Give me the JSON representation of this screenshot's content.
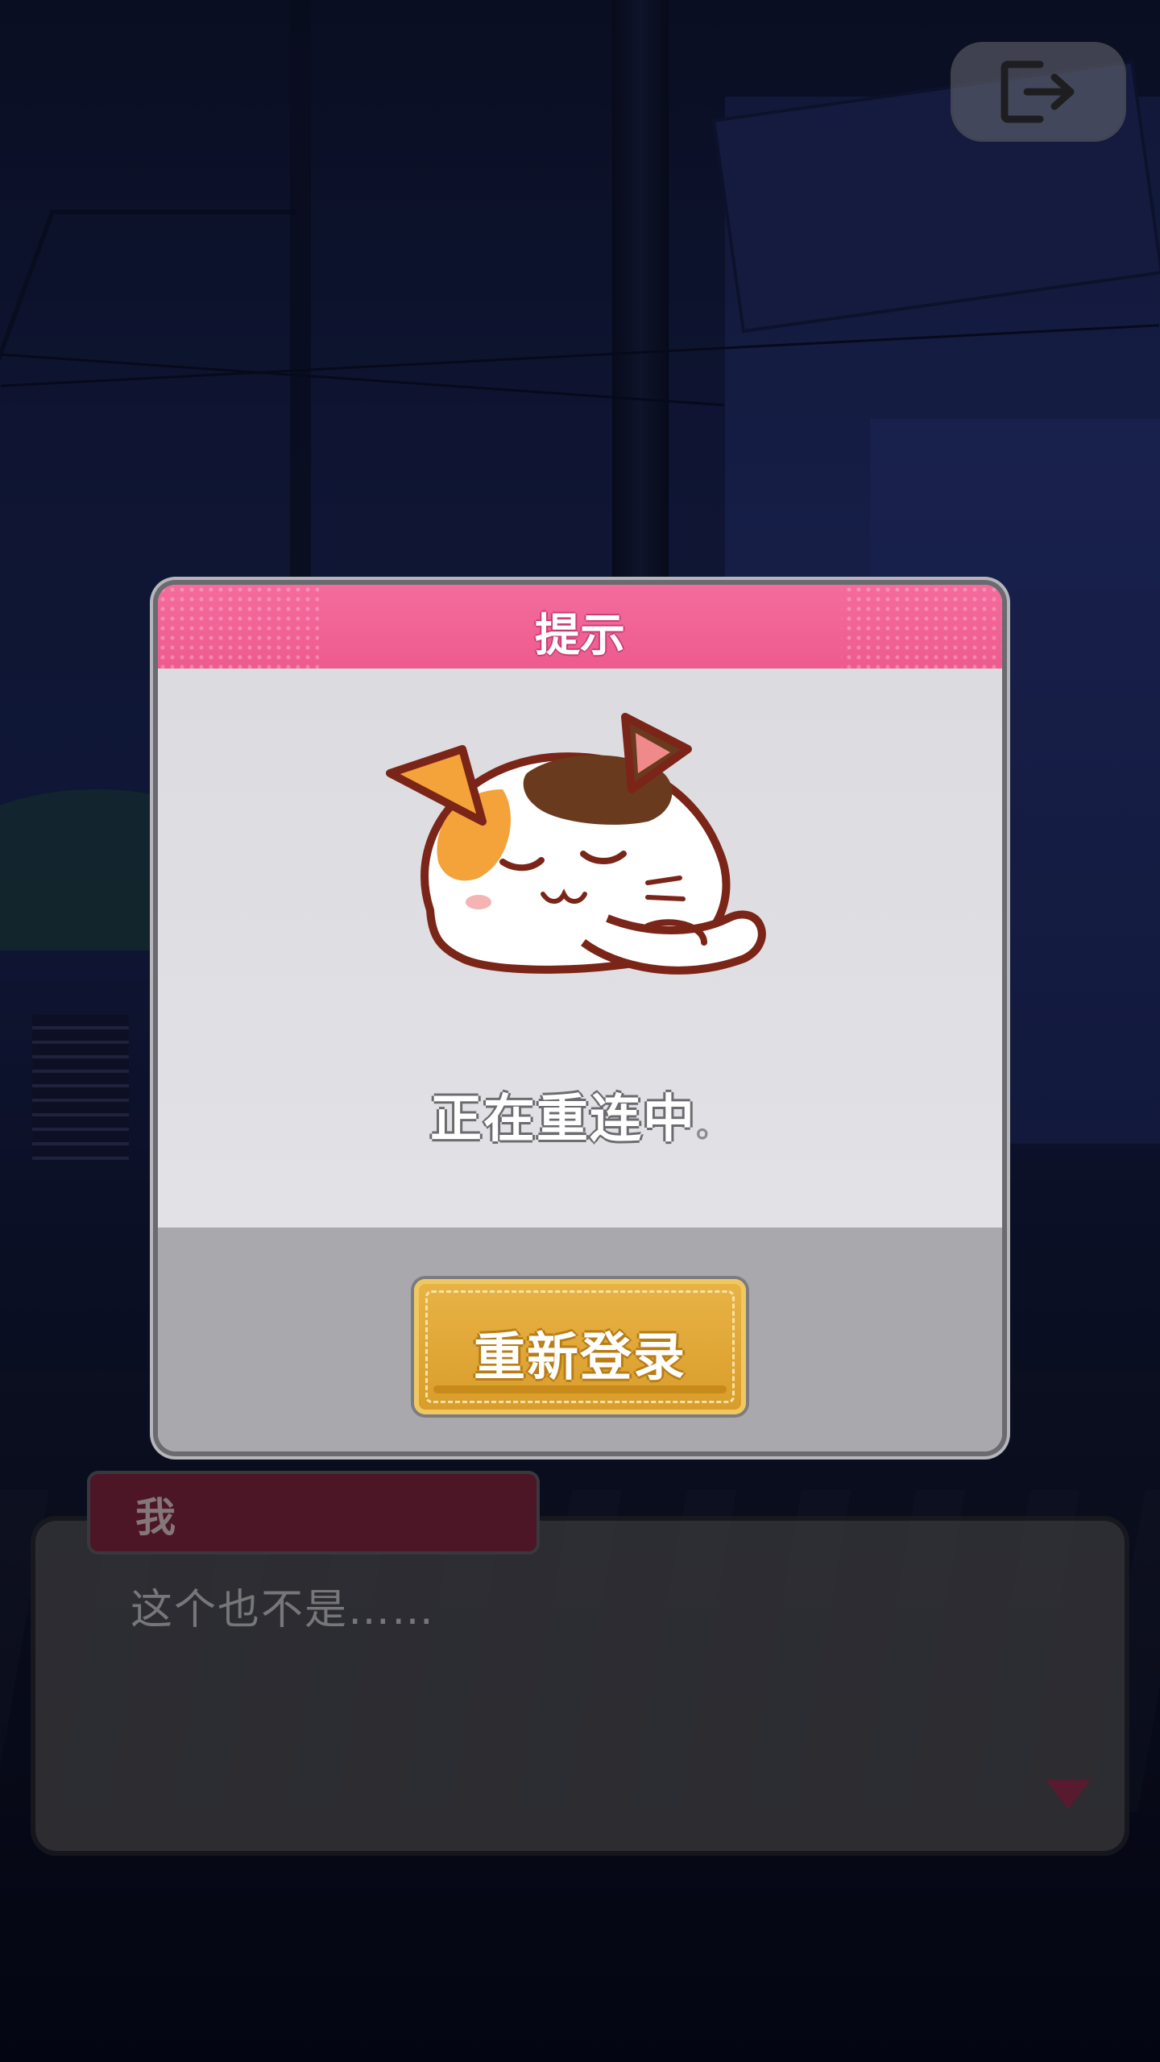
{
  "hud": {
    "exit_icon": "exit-icon"
  },
  "dialogue": {
    "speaker": "我",
    "text": "这个也不是……",
    "advance_icon": "triangle-down-icon"
  },
  "modal": {
    "title": "提示",
    "mascot_icon": "sleeping-cat-icon",
    "status": "正在重连中",
    "status_indicator": "。",
    "button_label": "重新登录"
  },
  "colors": {
    "header_pink": "#ee5b8e",
    "button_gold": "#d99c2a",
    "speaker_tag": "#6b1f35"
  }
}
